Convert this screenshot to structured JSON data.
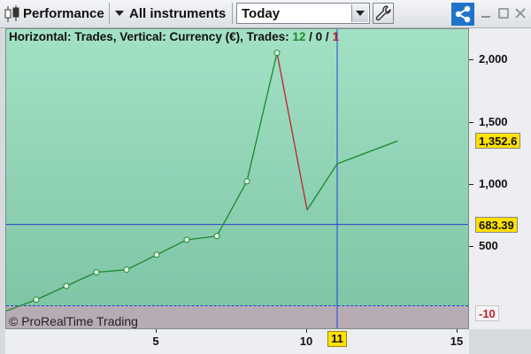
{
  "toolbar": {
    "candles_icon": "candlestick-chart-icon",
    "performance_label": "Performance",
    "instruments_label": "All instruments",
    "period_value": "Today",
    "wrench_icon": "wrench-icon",
    "share_icon": "share-icon",
    "window_buttons": [
      "minimize",
      "maximize",
      "close"
    ]
  },
  "chart_header": {
    "prefix": "Horizontal: Trades, Vertical: Currency (€), Trades: ",
    "trades_won": "12",
    "sep1": " / ",
    "trades_neutral": "0",
    "sep2": " / ",
    "trades_lost": "1"
  },
  "copyright": "© ProRealTime Trading",
  "colors": {
    "plot_top": "#a3e1c5",
    "plot_bottom": "#7cc3a4",
    "gain_line": "#1c8a2c",
    "loss_line": "#c0222a",
    "crosshair": "#2b3fd0",
    "tag_yellow": "#ffe100"
  },
  "chart_data": {
    "type": "line",
    "xlabel": "Trades",
    "ylabel": "Currency (€)",
    "xlim": [
      0,
      15
    ],
    "ylim": [
      -150,
      2250
    ],
    "x_ticks": [
      "5",
      "10",
      "15"
    ],
    "y_ticks": [
      "500",
      "1,000",
      "1,500",
      "2,000"
    ],
    "x": [
      0,
      1,
      2,
      3,
      4,
      5,
      6,
      7,
      8,
      9,
      10,
      11,
      13
    ],
    "y": [
      -10,
      80,
      190,
      300,
      320,
      440,
      560,
      590,
      1030,
      2060,
      800,
      1170,
      1352.6
    ],
    "marker_indices": [
      1,
      2,
      3,
      4,
      5,
      6,
      7,
      8,
      9
    ],
    "loss_segment": [
      9,
      10
    ],
    "crosshair": {
      "x": 11,
      "y": 683.39
    },
    "last_value_label": "1,352.6",
    "crosshair_y_label": "683.39",
    "crosshair_x_label": "11",
    "zero_line_label": "-10"
  }
}
